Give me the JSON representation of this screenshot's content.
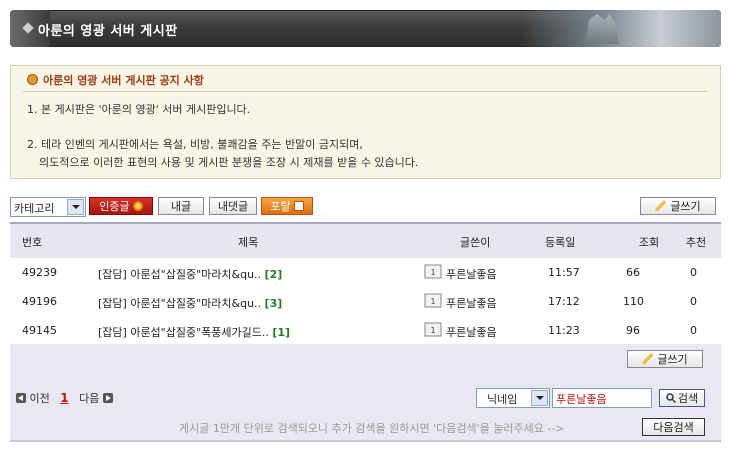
{
  "header": {
    "title": "아룬의 영광 서버 게시판"
  },
  "notice": {
    "title": "아룬의 영광 서버 게시판 공지 사항",
    "lines": [
      "1. 본 게시판은 '아룬의 영광' 서버 게시판입니다.",
      "2. 테라 인벤의 게시판에서는 욕설, 비방, 불쾌감을 주는 반말이 금지되며,",
      "의도적으로 이러한 표현의 사용 및 게시판 분쟁을 조장 시 제재를 받을 수 있습니다."
    ]
  },
  "toolbar": {
    "category_value": "카테고리",
    "certified_label": "인증글",
    "my_posts_label": "내글",
    "my_comments_label": "내댓글",
    "portal_label": "포탈",
    "write_label": "글쓰기"
  },
  "table": {
    "headers": {
      "no": "번호",
      "subject": "제목",
      "author": "글쓴이",
      "date": "등록일",
      "views": "조회",
      "recommend": "추천"
    },
    "rows": [
      {
        "no": "49239",
        "subject": "[잡담]  아룬섭\"삽질중\"마라치&qu..",
        "comments": "[2]",
        "author": "푸른날좋음",
        "date": "11:57",
        "views": "66",
        "recommend": "0"
      },
      {
        "no": "49196",
        "subject": "[잡담]  아룬섭\"삽질중\"마라치&qu..",
        "comments": "[3]",
        "author": "푸른날좋음",
        "date": "17:12",
        "views": "110",
        "recommend": "0"
      },
      {
        "no": "49145",
        "subject": "[잡담]  아룬섭\"삽질중\"폭풍세가길드..",
        "comments": "[1]",
        "author": "푸른날좋음",
        "date": "11:23",
        "views": "96",
        "recommend": "0"
      }
    ]
  },
  "footer": {
    "write_label": "글쓰기",
    "prev_label": "이전",
    "current_page": "1",
    "next_label": "다음",
    "search_type": "닉네임",
    "search_value": "푸른날좋음",
    "search_button": "검색",
    "hint": "게시글 1만개 단위로 검색되오니 추가 검색을 원하시면 '다음검색'을 눌러주세요 -->",
    "next_search_button": "다음검색"
  },
  "colors": {
    "accent_red": "#d01010",
    "comment_green": "#2a7a2a",
    "header_bg": "#e6e6f0"
  }
}
